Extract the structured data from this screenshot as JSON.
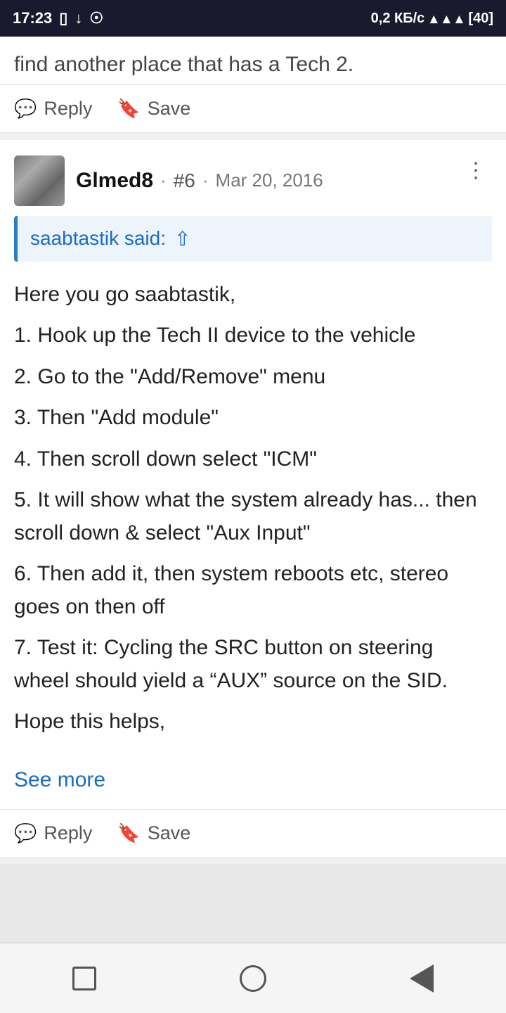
{
  "statusBar": {
    "time": "17:23",
    "rightInfo": "0,2 КБ/с",
    "battery": "40"
  },
  "topPost": {
    "partialText": "find another place that has a Tech 2."
  },
  "topActionBar": {
    "replyLabel": "Reply",
    "saveLabel": "Save"
  },
  "post": {
    "username": "Glmed8",
    "postNumber": "#6",
    "date": "Mar 20, 2016",
    "quotedUser": "saabtastik said:",
    "body": {
      "greeting": "Here you go saabtastik,",
      "steps": [
        "1. Hook up the Tech II device to the vehicle",
        "2. Go to the \"Add/Remove\" menu",
        "3. Then \"Add module\"",
        "4. Then scroll down select \"ICM\"",
        "5. It will show what the system already has... then scroll down & select \"Aux Input\"",
        "6. Then add it, then system reboots etc, stereo goes on then off",
        "7. Test it: Cycling the SRC button on steering wheel should yield a “AUX” source on the SID."
      ],
      "closing": "Hope this helps,"
    },
    "seeMore": "See more"
  },
  "bottomActionBar": {
    "replyLabel": "Reply",
    "saveLabel": "Save"
  },
  "navBar": {
    "squareTitle": "recent-apps",
    "circleTitle": "home",
    "triangleTitle": "back"
  }
}
